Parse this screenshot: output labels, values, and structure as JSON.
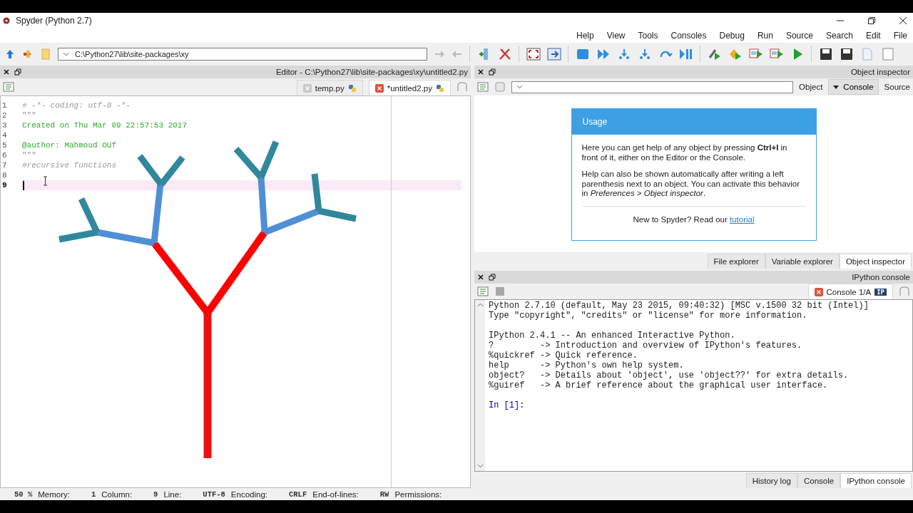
{
  "window": {
    "title": "Spyder (Python 2.7)"
  },
  "menu": [
    "Help",
    "View",
    "Tools",
    "Consoles",
    "Debug",
    "Run",
    "Source",
    "Search",
    "Edit",
    "File"
  ],
  "toolbar": {
    "path": "C:\\Python27\\lib\\site-packages\\xy"
  },
  "editor": {
    "title": "Editor - C:\\Python27\\lib\\site-packages\\xy\\untitled2.py",
    "tabs": [
      {
        "label": "temp.py",
        "selected": false
      },
      {
        "label": "*untitled2.py",
        "selected": true
      }
    ],
    "lines": [
      {
        "number": "1",
        "text": "# -*- coding: utf-8 -*-",
        "kind": "comment",
        "current": false
      },
      {
        "number": "2",
        "text": "\"\"\"",
        "kind": "quote",
        "current": false
      },
      {
        "number": "3",
        "text": "Created on Thu Mar 09 22:57:53 2017",
        "kind": "string",
        "current": false
      },
      {
        "number": "4",
        "current": false
      },
      {
        "number": "5",
        "text": "@author: Mahmoud OUf",
        "kind": "string",
        "current": false
      },
      {
        "number": "6",
        "text": "\"\"\"",
        "kind": "quote",
        "current": false
      },
      {
        "number": "7",
        "text": "#recursive functions",
        "kind": "comment",
        "current": false
      },
      {
        "number": "8",
        "current": false
      },
      {
        "number": "9",
        "current": true
      }
    ]
  },
  "object_inspector": {
    "title": "Object inspector",
    "object_label": "Object",
    "source_button": "Console",
    "source_label": "Source",
    "usage": {
      "heading": "Usage",
      "paragraphs": [
        "Here you can get help of any object by pressing **Ctrl+I** in front of it, either on the Editor or the Console.",
        "Help can also be shown automatically after writing a left parenthesis next to an object. You can activate this behavior in *Preferences > Object inspector*."
      ],
      "footer": "New to Spyder? Read our",
      "link": "tutorial"
    },
    "tabs": [
      {
        "label": "File explorer",
        "selected": false
      },
      {
        "label": "Variable explorer",
        "selected": false
      },
      {
        "label": "Object inspector",
        "selected": true
      }
    ]
  },
  "console": {
    "title": "IPython console",
    "tab": "Console 1/A",
    "badge": "IP",
    "blocks": [
      [
        "Python 2.7.10 (default, May 23 2015, 09:40:32) [MSC v.1500 32 bit (Intel)]",
        "Type \"copyright\", \"credits\" or \"license\" for more information."
      ],
      [
        "IPython 2.4.1 -- An enhanced Interactive Python.",
        "?         -> Introduction and overview of IPython's features.",
        "%quickref -> Quick reference.",
        "help      -> Python's own help system.",
        "object?   -> Details about 'object', use 'object??' for extra details.",
        "%guiref   -> A brief reference about the graphical user interface."
      ]
    ],
    "prompt": "In [1]:",
    "tabs": [
      {
        "label": "History log",
        "selected": false
      },
      {
        "label": "Console",
        "selected": false
      },
      {
        "label": "IPython console",
        "selected": true
      }
    ]
  },
  "status_bar": [
    {
      "text": "50 %",
      "kind": "value"
    },
    {
      "text": "Memory:",
      "kind": "label"
    },
    {
      "text": "1",
      "kind": "value"
    },
    {
      "text": "Column:",
      "kind": "label"
    },
    {
      "text": "9",
      "kind": "value"
    },
    {
      "text": "Line:",
      "kind": "label"
    },
    {
      "text": "UTF-8",
      "kind": "value"
    },
    {
      "text": "Encoding:",
      "kind": "label"
    },
    {
      "text": "CRLF",
      "kind": "value"
    },
    {
      "text": "End-of-lines:",
      "kind": "label"
    },
    {
      "text": "RW",
      "kind": "value"
    },
    {
      "text": "Permissions:",
      "kind": "label"
    }
  ]
}
